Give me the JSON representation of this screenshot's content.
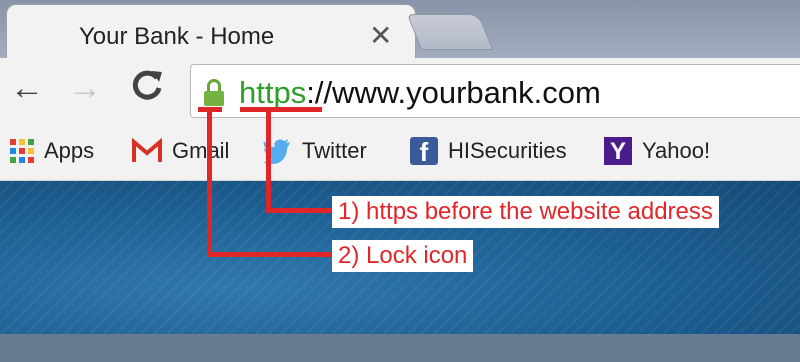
{
  "tab": {
    "title": "Your Bank - Home",
    "close": "✕"
  },
  "toolbar": {
    "back": "←",
    "forward": "→",
    "reload": "C"
  },
  "omnibox": {
    "scheme": "https",
    "rest": "://www.yourbank.com"
  },
  "bookmarks": [
    {
      "label": "Apps",
      "icon": "apps-grid-icon"
    },
    {
      "label": "Gmail",
      "icon": "gmail-icon"
    },
    {
      "label": "Twitter",
      "icon": "twitter-icon"
    },
    {
      "label": "HISecurities",
      "icon": "facebook-icon"
    },
    {
      "label": "Yahoo!",
      "icon": "yahoo-icon"
    }
  ],
  "annotations": {
    "https": "1) https before the website address",
    "lock": "2) Lock icon",
    "color": "#e1262a"
  },
  "icons": {
    "facebook_letter": "f",
    "yahoo_letter": "Y"
  },
  "colors": {
    "https_green": "#2e9d2c",
    "page_blue": "#1b5b8d"
  }
}
